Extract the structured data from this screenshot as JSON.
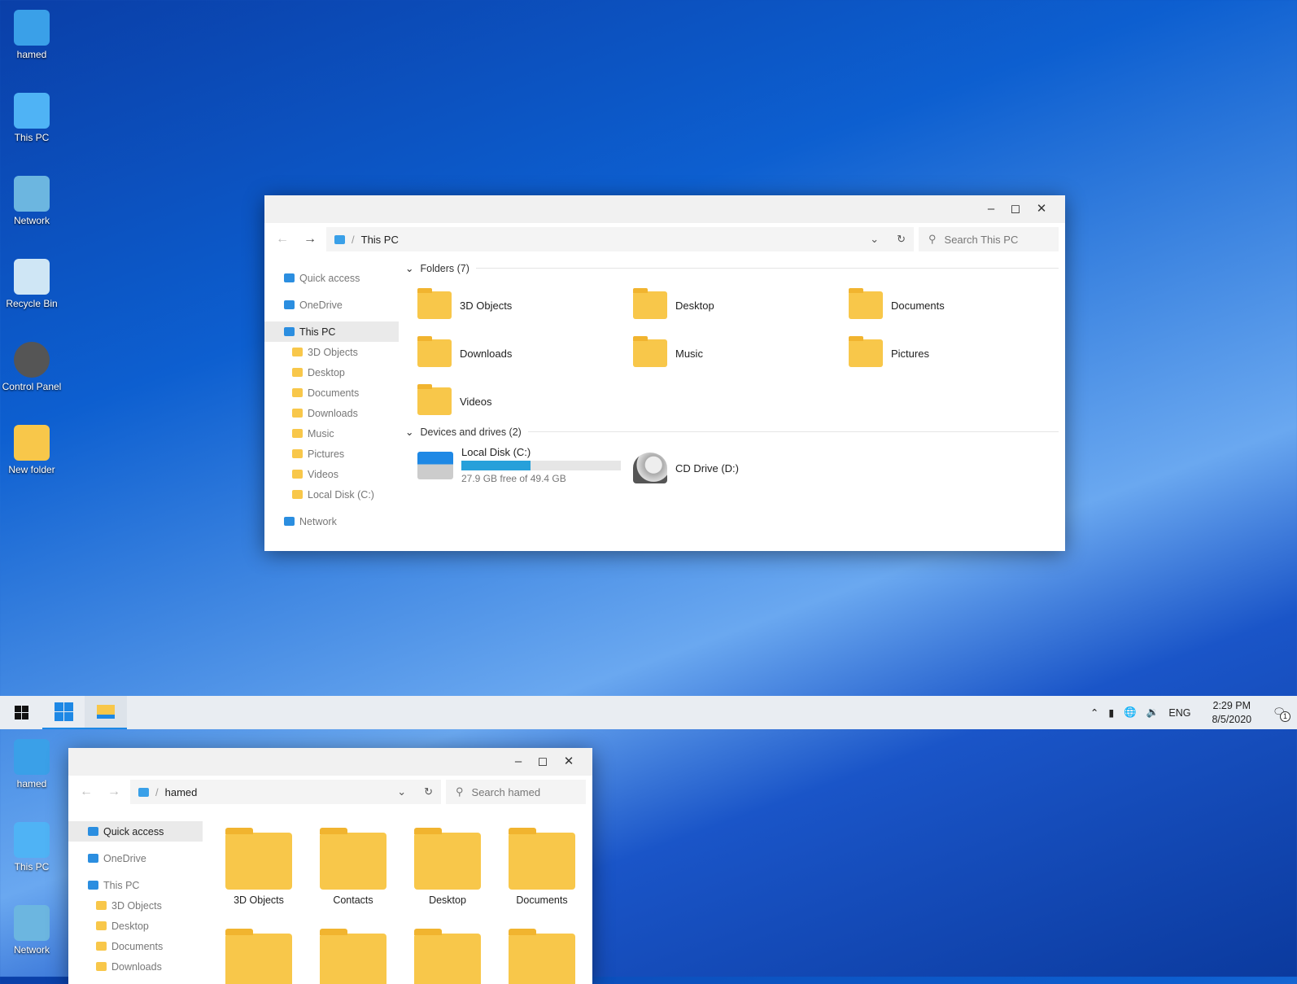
{
  "desktop_top": [
    {
      "label": "hamed",
      "icon": "user-folder-icon"
    },
    {
      "label": "This PC",
      "icon": "monitor-icon"
    },
    {
      "label": "Network",
      "icon": "network-icon"
    },
    {
      "label": "Recycle Bin",
      "icon": "recycle-bin-icon"
    },
    {
      "label": "Control Panel",
      "icon": "control-panel-icon"
    },
    {
      "label": "New folder",
      "icon": "folder-icon"
    }
  ],
  "desktop_bottom": [
    {
      "label": "hamed"
    },
    {
      "label": "This PC"
    },
    {
      "label": "Network"
    }
  ],
  "main_window": {
    "address": "This PC",
    "search_placeholder": "Search This PC",
    "sidebar": [
      {
        "label": "Quick access",
        "level": 0
      },
      {
        "label": "OneDrive",
        "level": 0
      },
      {
        "label": "This PC",
        "level": 0,
        "selected": true
      },
      {
        "label": "3D Objects",
        "level": 1
      },
      {
        "label": "Desktop",
        "level": 1
      },
      {
        "label": "Documents",
        "level": 1
      },
      {
        "label": "Downloads",
        "level": 1
      },
      {
        "label": "Music",
        "level": 1
      },
      {
        "label": "Pictures",
        "level": 1
      },
      {
        "label": "Videos",
        "level": 1
      },
      {
        "label": "Local Disk (C:)",
        "level": 1
      },
      {
        "label": "Network",
        "level": 0
      }
    ],
    "folders_header": "Folders (7)",
    "folders": [
      "3D Objects",
      "Desktop",
      "Documents",
      "Downloads",
      "Music",
      "Pictures",
      "Videos"
    ],
    "devices_header": "Devices and drives (2)",
    "drives": [
      {
        "name": "Local Disk (C:)",
        "free": "27.9 GB free of 49.4 GB",
        "used_fraction": 0.435
      },
      {
        "name": "CD Drive (D:)"
      }
    ]
  },
  "second_window": {
    "address": "hamed",
    "search_placeholder": "Search hamed",
    "sidebar": [
      {
        "label": "Quick access",
        "selected": true
      },
      {
        "label": "OneDrive"
      },
      {
        "label": "This PC"
      },
      {
        "label": "3D Objects"
      },
      {
        "label": "Desktop"
      },
      {
        "label": "Documents"
      },
      {
        "label": "Downloads"
      }
    ],
    "items": [
      "3D Objects",
      "Contacts",
      "Desktop",
      "Documents"
    ]
  },
  "taskbar": {
    "language": "ENG",
    "time": "2:29 PM",
    "date": "8/5/2020",
    "notification_count": "1"
  },
  "colors": {
    "accent": "#1e88e5",
    "progress": "#26a0da",
    "folder": "#f8c74a"
  }
}
